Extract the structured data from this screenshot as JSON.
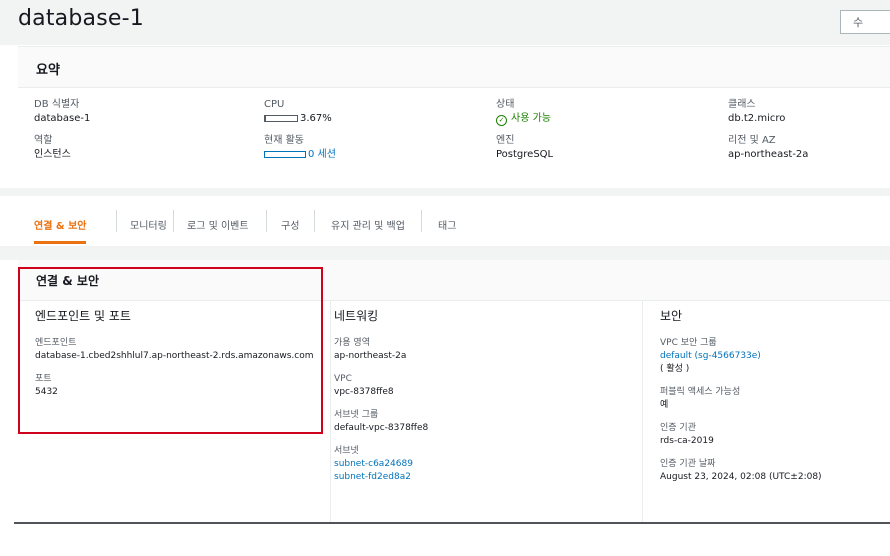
{
  "header": {
    "title": "database-1",
    "button_label": "수"
  },
  "summary": {
    "title": "요약",
    "db_id_label": "DB 식별자",
    "db_id_value": "database-1",
    "role_label": "역할",
    "role_value": "인스턴스",
    "cpu_label": "CPU",
    "cpu_value": "3.67%",
    "cpu_fraction": 0.0367,
    "activity_label": "현재 활동",
    "activity_value": "0 세션",
    "status_label": "상태",
    "status_value": "사용 가능",
    "engine_label": "엔진",
    "engine_value": "PostgreSQL",
    "class_label": "클래스",
    "class_value": "db.t2.micro",
    "region_label": "리전 및 AZ",
    "region_value": "ap-northeast-2a"
  },
  "tabs": [
    {
      "label": "연결 & 보안",
      "active": true
    },
    {
      "label": "모니터링"
    },
    {
      "label": "로그 및 이벤트"
    },
    {
      "label": "구성"
    },
    {
      "label": "유지 관리 및 백업"
    },
    {
      "label": "태그"
    }
  ],
  "connectivity": {
    "title": "연결 & 보안",
    "endpoint_section": {
      "heading": "엔드포인트 및 포트",
      "endpoint_label": "엔드포인트",
      "endpoint_value": "database-1.cbed2shhlul7.ap-northeast-2.rds.amazonaws.com",
      "port_label": "포트",
      "port_value": "5432"
    },
    "network_section": {
      "heading": "네트워킹",
      "az_label": "가용 영역",
      "az_value": "ap-northeast-2a",
      "vpc_label": "VPC",
      "vpc_value": "vpc-8378ffe8",
      "subnet_group_label": "서브넷 그룹",
      "subnet_group_value": "default-vpc-8378ffe8",
      "subnets_label": "서브넷",
      "subnet_1": "subnet-c6a24689",
      "subnet_2": "subnet-fd2ed8a2"
    },
    "security_section": {
      "heading": "보안",
      "sg_label": "VPC 보안 그룹",
      "sg_value": "default (sg-4566733e)",
      "sg_status": "( 활성 )",
      "public_label": "퍼블릭 액세스 가능성",
      "public_value": "예",
      "ca_label": "인증 기관",
      "ca_value": "rds-ca-2019",
      "ca_date_label": "인증 기관 날짜",
      "ca_date_value": "August 23, 2024, 02:08 (UTC±2:08)"
    }
  },
  "colors": {
    "accent": "#ec7211",
    "link": "#0073bb",
    "success": "#1d8102",
    "highlight": "#d0021b"
  }
}
